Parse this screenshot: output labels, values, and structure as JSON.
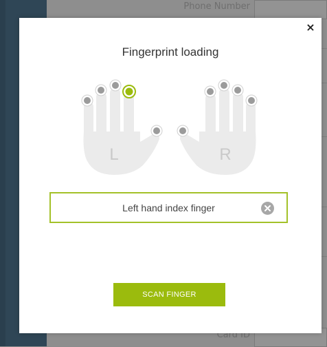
{
  "background": {
    "phone_label": "Phone Number",
    "card_label": "Card ID"
  },
  "modal": {
    "close_symbol": "×",
    "title": "Fingerprint loading",
    "left_hand_letter": "L",
    "right_hand_letter": "R",
    "selected_finger_text": "Left hand index finger",
    "scan_button_label": "SCAN FINGER",
    "accent_color": "#9bbb0d",
    "selected_finger": "left-index"
  }
}
